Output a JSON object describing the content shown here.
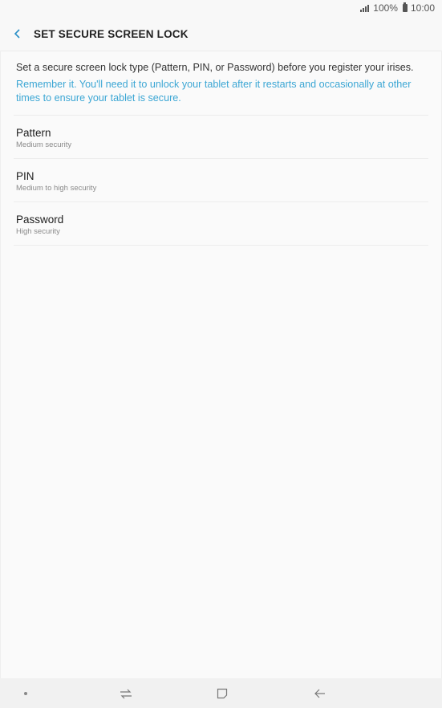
{
  "status_bar": {
    "battery_percent": "100%",
    "time": "10:00"
  },
  "header": {
    "title": "SET SECURE SCREEN LOCK"
  },
  "content": {
    "description": "Set a secure screen lock type (Pattern, PIN, or Password) before you register your irises.",
    "note": "Remember it. You'll need it to unlock your tablet after it restarts and occasionally at other times to ensure your tablet is secure.",
    "options": [
      {
        "title": "Pattern",
        "subtitle": "Medium security"
      },
      {
        "title": "PIN",
        "subtitle": "Medium to high security"
      },
      {
        "title": "Password",
        "subtitle": "High security"
      }
    ]
  },
  "colors": {
    "accent": "#3ba6d4",
    "background": "#f8f8f8"
  }
}
